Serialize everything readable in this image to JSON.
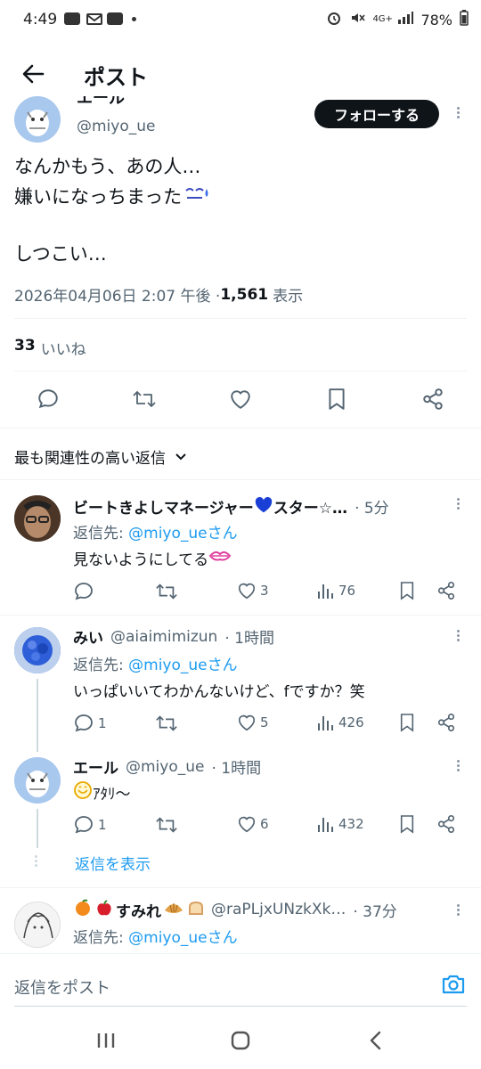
{
  "status_bar": {
    "time": "4:49",
    "battery": "78%",
    "network": "4G+"
  },
  "header": {
    "title": "ポスト"
  },
  "post": {
    "author_name": "エール",
    "handle": "@miyo_ue",
    "follow_label": "フォローする",
    "line1": "なんかもう、あの人…",
    "line2": "嫌いになっちまった",
    "line3": "しつこい…",
    "timestamp": "2026年04月06日 2:07 午後 · ",
    "views_count": "1,561",
    "views_label": "表示",
    "likes_count": "33",
    "likes_label": "いいね"
  },
  "sort_label": "最も関連性の高い返信",
  "replies": [
    {
      "name": "ビートきよしマネージャー",
      "name_suffix": "スター☆…",
      "time": "· 5分",
      "reply_to_prefix": "返信先: ",
      "reply_to": "@miyo_ueさん",
      "text": "見ないようにしてる",
      "replies": "",
      "likes": "3",
      "views": "76"
    },
    {
      "name": "みい",
      "handle": "@aiaimimizun",
      "time": "· 1時間",
      "reply_to_prefix": "返信先: ",
      "reply_to": "@miyo_ueさん",
      "text": "いっぱいいてわかんないけど、fですか？笑",
      "replies": "1",
      "likes": "5",
      "views": "426"
    },
    {
      "name": "エール",
      "handle": "@miyo_ue",
      "time": "· 1時間",
      "text": "ｱﾀﾘ～",
      "replies": "1",
      "likes": "6",
      "views": "432"
    },
    {
      "name": "すみれ",
      "handle": "@raPLjxUNzkXk…",
      "time": "· 37分",
      "reply_to_prefix": "返信先: ",
      "reply_to": "@miyo_ueさん"
    }
  ],
  "show_replies_label": "返信を表示",
  "compose": {
    "placeholder": "返信をポスト"
  },
  "colors": {
    "accent": "#1d9bf0",
    "text": "#0f1419",
    "muted": "#536471",
    "divider": "#eff3f4"
  }
}
